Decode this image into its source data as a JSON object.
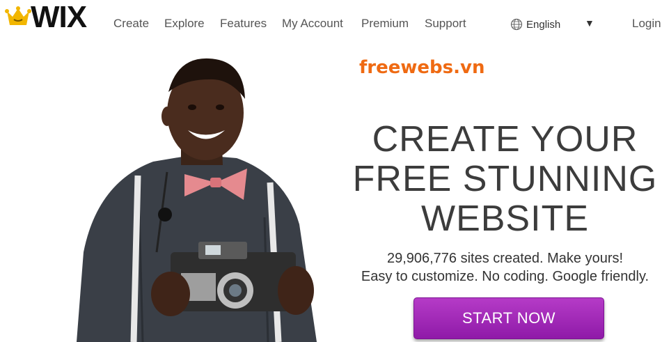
{
  "brand": {
    "logo_text": "WIX"
  },
  "nav": {
    "items": [
      {
        "label": "Create"
      },
      {
        "label": "Explore"
      },
      {
        "label": "Features"
      },
      {
        "label": "My Account"
      },
      {
        "label": "Premium"
      },
      {
        "label": "Support"
      }
    ],
    "language": "English",
    "login": "Login"
  },
  "hero": {
    "watermark": "freewebs.vn",
    "headline_lines": [
      "CREATE YOUR",
      "FREE STUNNING",
      "WEBSITE"
    ],
    "sites_created": "29,906,776 sites created. Make yours!",
    "tagline": "Easy to customize. No coding. Google friendly.",
    "cta_label": "START NOW"
  },
  "colors": {
    "cta": "#9c23b3",
    "watermark": "#ef6a12",
    "text": "#3c3c3c"
  },
  "icons": {
    "logo": "wix-crown-icon",
    "language": "globe-icon",
    "caret": "caret-down-icon"
  }
}
